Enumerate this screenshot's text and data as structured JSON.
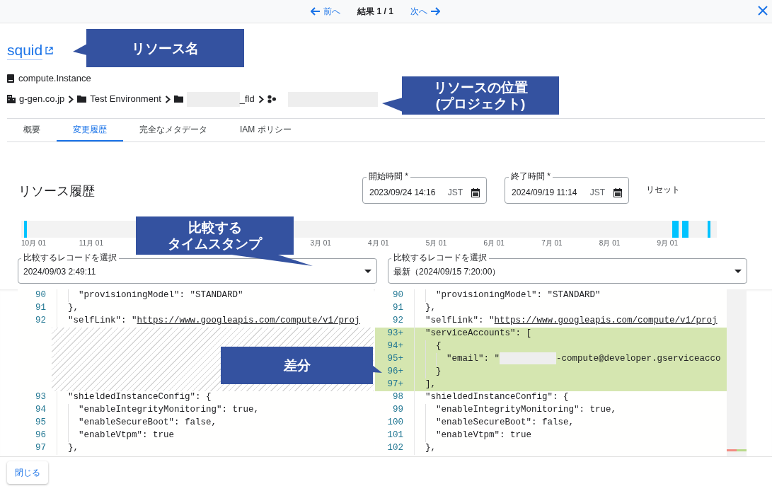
{
  "top_bar": {
    "prev": "前へ",
    "result": "結果 1 / 1",
    "next": "次へ"
  },
  "resource": {
    "name": "squid",
    "type": "compute.Instance"
  },
  "breadcrumb": [
    {
      "kind": "org",
      "label": "g-gen.co.jp",
      "redacted": false
    },
    {
      "kind": "folder",
      "label": "Test Environment",
      "redacted": false
    },
    {
      "kind": "folder",
      "label": "_fld",
      "redacted": true
    },
    {
      "kind": "project",
      "redacted": true
    }
  ],
  "tabs": [
    {
      "label": "概要",
      "selected": false
    },
    {
      "label": "変更履歴",
      "selected": true
    },
    {
      "label": "完全なメタデータ",
      "selected": false
    },
    {
      "label": "IAM ポリシー",
      "selected": false
    }
  ],
  "history": {
    "title": "リソース履歴",
    "start": {
      "label": "開始時間 *",
      "value": "2023/09/24 14:16",
      "zone": "JST"
    },
    "end": {
      "label": "終了時間 *",
      "value": "2024/09/19 11:14",
      "zone": "JST"
    },
    "reset": "リセット",
    "ticks_before_callout": [
      "10月 01",
      "11月 01"
    ],
    "ticks_after_callout": [
      "3月 01",
      "4月 01",
      "5月 01",
      "6月 01",
      "7月 01",
      "8月 01",
      "9月 01"
    ],
    "selects": [
      {
        "label": "比較するレコードを選択",
        "value": "2024/09/03 2:49:11"
      },
      {
        "label": "比較するレコードを選択",
        "value": "最新（2024/09/15 7:20:00）"
      }
    ]
  },
  "diff": {
    "left": [
      {
        "kind": "line",
        "num": "90",
        "code": "  \"provisioningModel\": \"STANDARD\""
      },
      {
        "kind": "line",
        "num": "91",
        "code": "},"
      },
      {
        "kind": "line",
        "num": "92",
        "code": "\"selfLink\": \"",
        "link": "https://www.googleapis.com/compute/v1/proj"
      },
      {
        "kind": "gap"
      },
      {
        "kind": "line",
        "num": "93",
        "code": "\"shieldedInstanceConfig\": {"
      },
      {
        "kind": "line",
        "num": "94",
        "code": "  \"enableIntegrityMonitoring\": true,"
      },
      {
        "kind": "line",
        "num": "95",
        "code": "  \"enableSecureBoot\": false,"
      },
      {
        "kind": "line",
        "num": "96",
        "code": "  \"enableVtpm\": true"
      },
      {
        "kind": "line",
        "num": "97",
        "code": "},"
      }
    ],
    "right": [
      {
        "kind": "line",
        "num": "90",
        "code": "  \"provisioningModel\": \"STANDARD\""
      },
      {
        "kind": "line",
        "num": "91",
        "code": "},"
      },
      {
        "kind": "line",
        "num": "92",
        "code": "\"selfLink\": \"",
        "link": "https://www.googleapis.com/compute/v1/proj"
      },
      {
        "kind": "added",
        "num": "93+",
        "code": "\"serviceAccounts\": ["
      },
      {
        "kind": "added",
        "num": "94+",
        "code": "  {"
      },
      {
        "kind": "added",
        "num": "95+",
        "code": "    \"email\": \"",
        "redacted_tail": "-compute@developer.gserviceacco"
      },
      {
        "kind": "added",
        "num": "96+",
        "code": "  }"
      },
      {
        "kind": "added",
        "num": "97+",
        "code": "],"
      },
      {
        "kind": "line",
        "num": "98",
        "code": "\"shieldedInstanceConfig\": {"
      },
      {
        "kind": "line",
        "num": "99",
        "code": "  \"enableIntegrityMonitoring\": true,"
      },
      {
        "kind": "line",
        "num": "100",
        "code": "  \"enableSecureBoot\": false,"
      },
      {
        "kind": "line",
        "num": "101",
        "code": "  \"enableVtpm\": true"
      },
      {
        "kind": "line",
        "num": "102",
        "code": "},"
      }
    ]
  },
  "footer": {
    "close": "閉じる"
  },
  "callouts": [
    {
      "lines": [
        "リソース名"
      ]
    },
    {
      "lines": [
        "リソースの位置",
        "(プロジェクト)"
      ]
    },
    {
      "lines": [
        "比較する",
        "タイムスタンプ"
      ]
    },
    {
      "lines": [
        "差分"
      ]
    }
  ]
}
